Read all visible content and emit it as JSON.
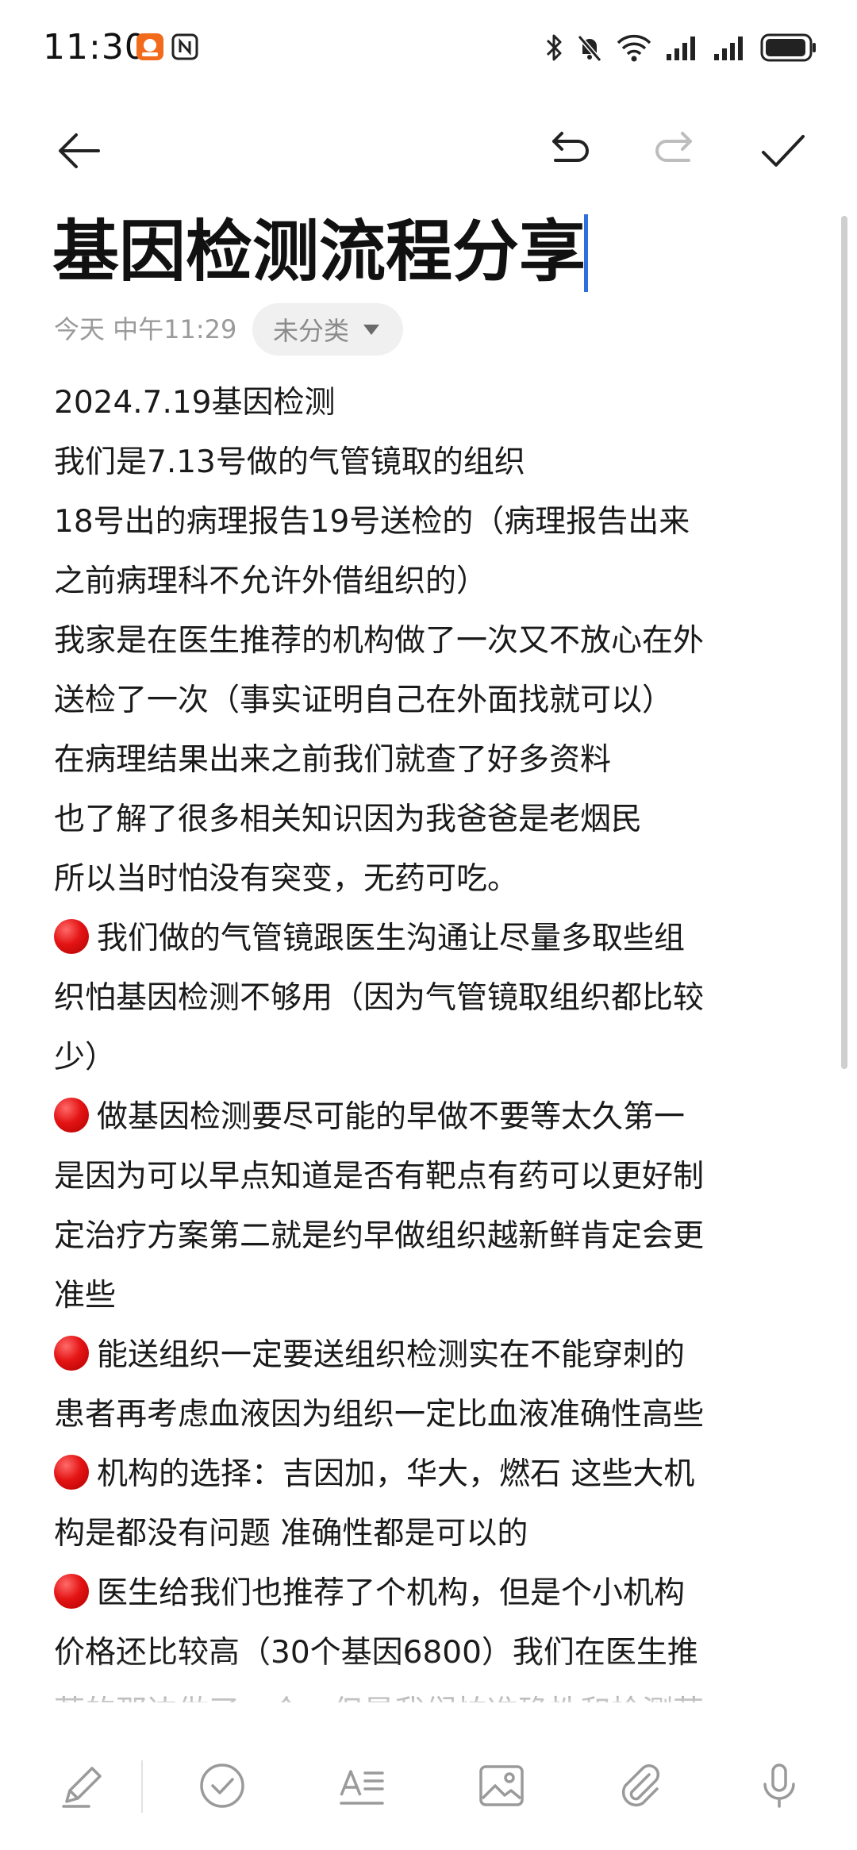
{
  "status_bar": {
    "time": "11:30"
  },
  "toolbar": {
    "back_icon": "arrow-left-icon",
    "undo_icon": "undo-icon",
    "redo_icon": "redo-icon",
    "done_icon": "check-icon"
  },
  "note": {
    "title": "基因检测流程分享",
    "date": "今天 中午11:29",
    "category": "未分类",
    "lines": [
      {
        "text": "2024.7.19基因检测",
        "bullet": false
      },
      {
        "text": "我们是7.13号做的气管镜取的组织",
        "bullet": false
      },
      {
        "text": "18号出的病理报告19号送检的（病理报告出来",
        "bullet": false
      },
      {
        "text": "之前病理科不允许外借组织的）",
        "bullet": false
      },
      {
        "text": "我家是在医生推荐的机构做了一次又不放心在外",
        "bullet": false
      },
      {
        "text": "送检了一次（事实证明自己在外面找就可以）",
        "bullet": false
      },
      {
        "text": "在病理结果出来之前我们就查了好多资料",
        "bullet": false
      },
      {
        "text": "也了解了很多相关知识因为我爸爸是老烟民",
        "bullet": false
      },
      {
        "text": "所以当时怕没有突变，无药可吃。",
        "bullet": false
      },
      {
        "text": "我们做的气管镜跟医生沟通让尽量多取些组",
        "bullet": true
      },
      {
        "text": "织怕基因检测不够用（因为气管镜取组织都比较",
        "bullet": false
      },
      {
        "text": "少）",
        "bullet": false
      },
      {
        "text": "做基因检测要尽可能的早做不要等太久第一",
        "bullet": true
      },
      {
        "text": "是因为可以早点知道是否有靶点有药可以更好制",
        "bullet": false
      },
      {
        "text": "定治疗方案第二就是约早做组织越新鲜肯定会更",
        "bullet": false
      },
      {
        "text": "准些",
        "bullet": false
      },
      {
        "text": "能送组织一定要送组织检测实在不能穿刺的",
        "bullet": true
      },
      {
        "text": "患者再考虑血液因为组织一定比血液准确性高些",
        "bullet": false
      },
      {
        "text": "机构的选择：吉因加，华大，燃石 这些大机",
        "bullet": true
      },
      {
        "text": "构是都没有问题 准确性都是可以的",
        "bullet": false
      },
      {
        "text": "医生给我们也推荐了个机构，但是个小机构",
        "bullet": true
      },
      {
        "text": "价格还比较高（30个基因6800）我们在医生推",
        "bullet": false
      },
      {
        "text": "荐的那边做了一个，但是我们怕准确性和检测范",
        "bullet": false
      }
    ]
  },
  "bottom_toolbar": {
    "items": [
      "pen-icon",
      "checklist-icon",
      "text-style-icon",
      "image-icon",
      "attachment-icon",
      "microphone-icon"
    ]
  },
  "colors": {
    "caret": "#2f6fdc",
    "bullet": "#e41414",
    "meta_text": "#9a9a9a",
    "chip_bg": "#f0f0f0"
  }
}
